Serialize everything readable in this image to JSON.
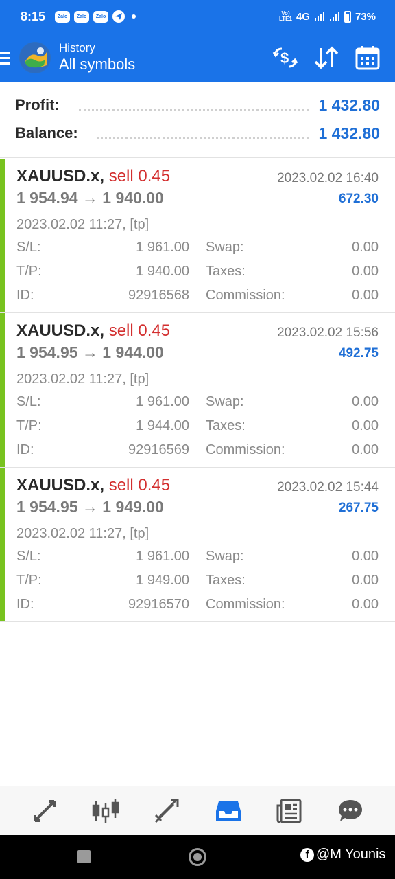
{
  "status_bar": {
    "time": "8:15",
    "app_icons": [
      "Zalo",
      "Zalo",
      "Zalo"
    ],
    "network_label": "4G",
    "volte_label": "Vo)\nLTE1",
    "battery": "73%"
  },
  "toolbar": {
    "subtitle": "History",
    "title": "All symbols",
    "icons": [
      "menu-icon",
      "app-logo",
      "currency-exchange-icon",
      "sort-icon",
      "calendar-icon"
    ]
  },
  "summary": {
    "profit_label": "Profit:",
    "profit_value": "1 432.80",
    "balance_label": "Balance:",
    "balance_value": "1 432.80"
  },
  "deals": [
    {
      "symbol": "XAUUSD.x,",
      "type": "sell 0.45",
      "close_time": "2023.02.02 16:40",
      "prices": "1 954.94 → 1 940.00",
      "profit": "672.30",
      "open_time": "2023.02.02 11:27, [tp]",
      "sl_label": "S/L:",
      "sl": "1 961.00",
      "tp_label": "T/P:",
      "tp": "1 940.00",
      "id_label": "ID:",
      "id": "92916568",
      "swap_label": "Swap:",
      "swap": "0.00",
      "taxes_label": "Taxes:",
      "taxes": "0.00",
      "commission_label": "Commission:",
      "commission": "0.00"
    },
    {
      "symbol": "XAUUSD.x,",
      "type": "sell 0.45",
      "close_time": "2023.02.02 15:56",
      "prices": "1 954.95 → 1 944.00",
      "profit": "492.75",
      "open_time": "2023.02.02 11:27, [tp]",
      "sl_label": "S/L:",
      "sl": "1 961.00",
      "tp_label": "T/P:",
      "tp": "1 944.00",
      "id_label": "ID:",
      "id": "92916569",
      "swap_label": "Swap:",
      "swap": "0.00",
      "taxes_label": "Taxes:",
      "taxes": "0.00",
      "commission_label": "Commission:",
      "commission": "0.00"
    },
    {
      "symbol": "XAUUSD.x,",
      "type": "sell 0.45",
      "close_time": "2023.02.02 15:44",
      "prices": "1 954.95 → 1 949.00",
      "profit": "267.75",
      "open_time": "2023.02.02 11:27, [tp]",
      "sl_label": "S/L:",
      "sl": "1 961.00",
      "tp_label": "T/P:",
      "tp": "1 949.00",
      "id_label": "ID:",
      "id": "92916570",
      "swap_label": "Swap:",
      "swap": "0.00",
      "taxes_label": "Taxes:",
      "taxes": "0.00",
      "commission_label": "Commission:",
      "commission": "0.00"
    }
  ],
  "bottom_nav": {
    "items": [
      "quotes-icon",
      "chart-icon",
      "trade-icon",
      "history-icon",
      "news-icon",
      "messages-icon"
    ],
    "active": "history-icon"
  },
  "watermark": "@M Younis",
  "colors": {
    "primary": "#1a73e8",
    "profit": "#1f6fd6",
    "sell": "#d32f2f",
    "accent_bar": "#78c31f",
    "nav_icon": "#555555"
  }
}
